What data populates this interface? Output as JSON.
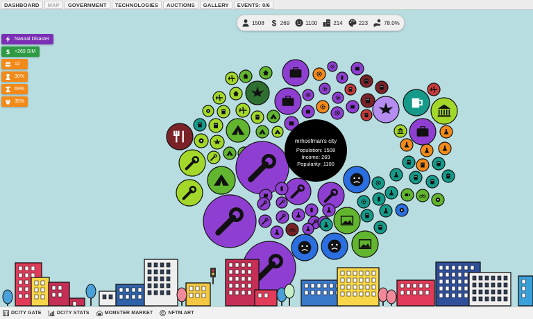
{
  "nav": {
    "tabs": [
      {
        "label": "DASHBOARD",
        "muted": false
      },
      {
        "label": "MAP",
        "muted": true
      },
      {
        "label": "GOVERNMENT",
        "muted": false
      },
      {
        "label": "TECHNOLOGIES",
        "muted": false
      },
      {
        "label": "AUCTIONS",
        "muted": false
      },
      {
        "label": "GALLERY",
        "muted": false
      },
      {
        "label": "EVENTS: 0/6",
        "muted": false
      }
    ]
  },
  "stats": {
    "population": "1508",
    "income": "269",
    "popularity": "1100",
    "stat4": "214",
    "stat5": "223",
    "stat6": "78.0%",
    "icons": [
      "person-icon",
      "dollar-icon",
      "smiley-icon",
      "buildings-icon",
      "palette-icon",
      "hand-coin-icon"
    ]
  },
  "badges": [
    {
      "label": "Natural Disaster",
      "color": "#7b2fb5",
      "icon": "lightning-icon"
    },
    {
      "label": "+269 SIM",
      "color": "#2e9b44",
      "icon": "dollar-icon"
    },
    {
      "label": "12",
      "color": "#f28a1a",
      "icon": "people-icon"
    },
    {
      "label": "30%",
      "color": "#f28a1a",
      "icon": "worker-icon"
    },
    {
      "label": "69%",
      "color": "#f28a1a",
      "icon": "student-icon"
    },
    {
      "label": "35%",
      "color": "#f28a1a",
      "icon": "fist-icon"
    }
  ],
  "city": {
    "name": "mrhoofman's city",
    "population_line": "Population: 1508",
    "income_line": "Income: 269",
    "popularity_line": "Popularity: 1100"
  },
  "bottom": {
    "links": [
      {
        "label": "DCITY GATE",
        "icon": "gate-icon"
      },
      {
        "label": "DCITY STATS",
        "icon": "chart-icon"
      },
      {
        "label": "MONSTER MARKET",
        "icon": "monster-icon"
      },
      {
        "label": "NFTM.ART",
        "icon": "copyright-icon"
      }
    ]
  },
  "colors": {
    "background": "#b7dde0",
    "purple": "#8e3fd1",
    "green": "#62b52e",
    "blue": "#2a6ee0",
    "teal": "#159a8a",
    "orange": "#f28a1a"
  }
}
